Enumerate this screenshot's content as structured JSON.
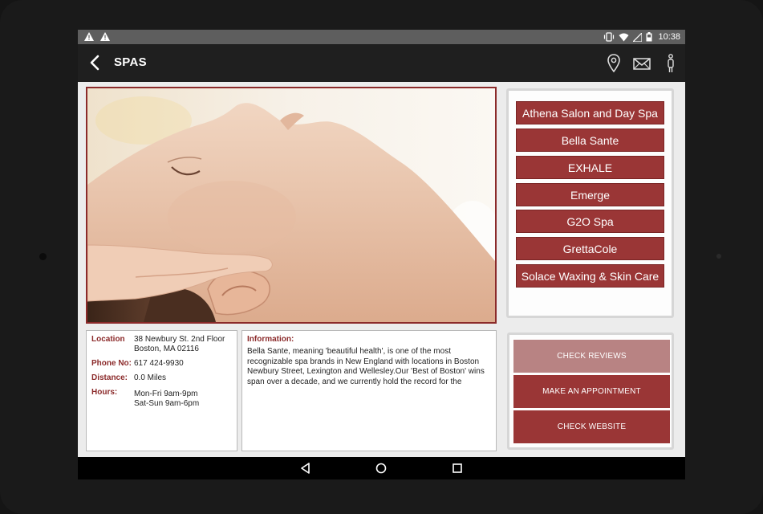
{
  "status_bar": {
    "time": "10:38",
    "icons": [
      "warning-icon",
      "warning-icon",
      "vibrate-icon",
      "wifi-icon",
      "signal-icon",
      "battery-icon"
    ]
  },
  "app_bar": {
    "title": "SPAS",
    "icons": [
      "back-arrow-icon",
      "location-pin-icon",
      "mail-icon",
      "info-person-icon"
    ]
  },
  "spa_list": [
    {
      "label": "Athena Salon and Day Spa"
    },
    {
      "label": "Bella Sante"
    },
    {
      "label": "EXHALE"
    },
    {
      "label": "Emerge"
    },
    {
      "label": "G2O Spa"
    },
    {
      "label": "GrettaCole"
    },
    {
      "label": "Solace Waxing & Skin Care"
    }
  ],
  "details": {
    "location_label": "Location",
    "location_line1": "38 Newbury St. 2nd Floor",
    "location_line2": "Boston, MA 02116",
    "phone_label": "Phone No:",
    "phone_value": "617 424-9930",
    "distance_label": "Distance:",
    "distance_value": "0.0 Miles",
    "hours_label": "Hours:",
    "hours_line1": "Mon-Fri 9am-9pm",
    "hours_line2": "Sat-Sun 9am-6pm"
  },
  "information": {
    "label": "Information:",
    "text": "Bella Sante, meaning 'beautiful health', is one of the most recognizable spa brands in New England with locations in Boston Newbury Street, Lexington and Wellesley.Our 'Best of Boston' wins span over a decade, and we currently hold the record for the"
  },
  "actions": {
    "reviews": "CHECK REVIEWS",
    "appointment": "MAKE AN APPOINTMENT",
    "website": "CHECK WEBSITE"
  },
  "nav_bar": {
    "icons": [
      "nav-back-icon",
      "nav-home-icon",
      "nav-recents-icon"
    ]
  },
  "colors": {
    "accent": "#9a3636",
    "accent_light": "#b88383",
    "app_bar": "#1f1f1f",
    "status_bar": "#5e5e5e"
  }
}
